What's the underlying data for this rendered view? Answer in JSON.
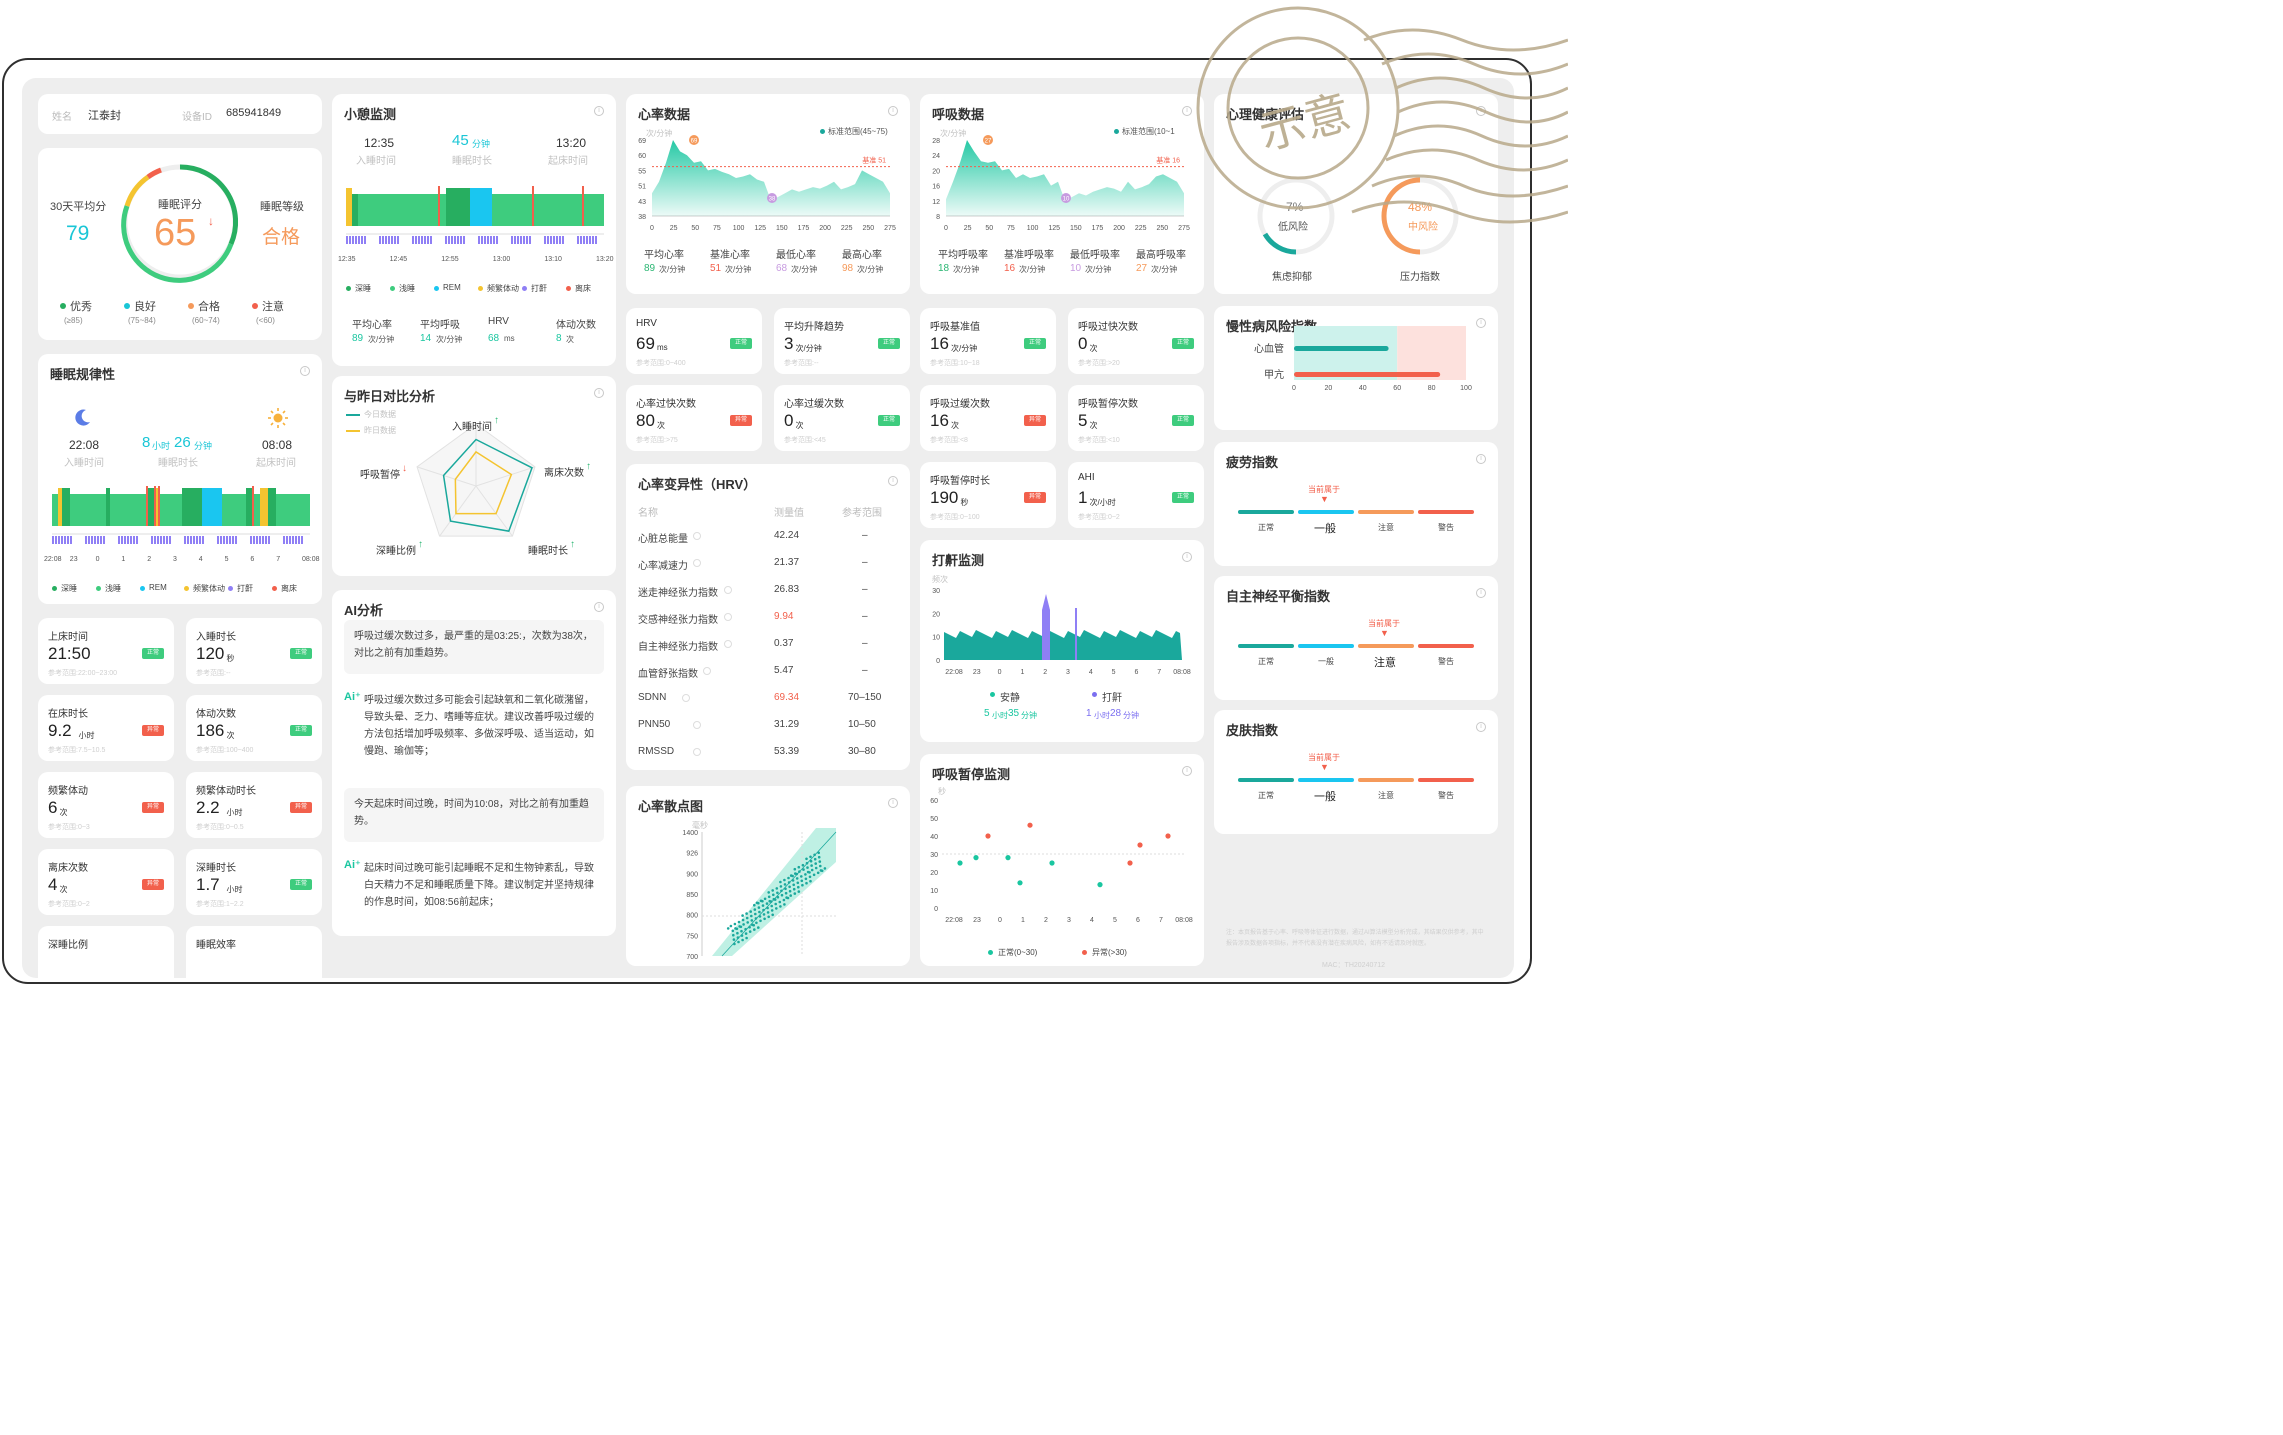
{
  "stamp": {
    "text": "示意"
  },
  "user": {
    "name_label": "姓名",
    "name": "江泰封",
    "device_label": "设备ID",
    "device_id": "685941849"
  },
  "score": {
    "avg_label": "30天平均分",
    "avg_value": "79",
    "score_label": "睡眠评分",
    "score_value": "65",
    "score_arrow": "↓",
    "level_label": "睡眠等级",
    "level_value": "合格",
    "legend": [
      {
        "name": "优秀",
        "range": "(≥85)",
        "color": "#27ae60"
      },
      {
        "name": "良好",
        "range": "(75~84)",
        "color": "#1ac6d6"
      },
      {
        "name": "合格",
        "range": "(60~74)",
        "color": "#f59a5b"
      },
      {
        "name": "注意",
        "range": "(<60)",
        "color": "#f2604c"
      }
    ]
  },
  "regularity": {
    "title": "睡眠规律性",
    "sleep_time": "22:08",
    "sleep_label": "入睡时间",
    "dur_h": "8",
    "dur_h_unit": "小时",
    "dur_m": "26",
    "dur_m_unit": "分钟",
    "dur_label": "睡眠时长",
    "wake_time": "08:08",
    "wake_label": "起床时间",
    "ticks": [
      "22:08",
      "23",
      "0",
      "1",
      "2",
      "3",
      "4",
      "5",
      "6",
      "7",
      "08:08"
    ],
    "legend": [
      "深睡",
      "浅睡",
      "REM",
      "频繁体动",
      "打鼾",
      "离床"
    ]
  },
  "metrics_left": [
    {
      "label": "上床时间",
      "value": "21:50",
      "unit": "",
      "ref": "参考范围:22:00~23:00",
      "status": "正常",
      "ok": true
    },
    {
      "label": "入睡时长",
      "value": "120",
      "unit": "秒",
      "ref": "参考范围:--",
      "status": "正常",
      "ok": true
    },
    {
      "label": "在床时长",
      "value": "9.2",
      "unit": "小时",
      "ref": "参考范围:7.5~10.5",
      "status": "异常",
      "ok": false
    },
    {
      "label": "体动次数",
      "value": "186",
      "unit": "次",
      "ref": "参考范围:100~400",
      "status": "正常",
      "ok": true
    },
    {
      "label": "频繁体动",
      "value": "6",
      "unit": "次",
      "ref": "参考范围:0~3",
      "status": "异常",
      "ok": false
    },
    {
      "label": "频繁体动时长",
      "value": "2.2",
      "unit": "小时",
      "ref": "参考范围:0~0.5",
      "status": "异常",
      "ok": false
    },
    {
      "label": "离床次数",
      "value": "4",
      "unit": "次",
      "ref": "参考范围:0~2",
      "status": "异常",
      "ok": false
    },
    {
      "label": "深睡时长",
      "value": "1.7",
      "unit": "小时",
      "ref": "参考范围:1~2.2",
      "status": "正常",
      "ok": true
    },
    {
      "label": "深睡比例",
      "value": "",
      "unit": "",
      "ref": "",
      "status": "",
      "ok": true
    },
    {
      "label": "睡眠效率",
      "value": "",
      "unit": "",
      "ref": "",
      "status": "",
      "ok": true
    }
  ],
  "nap": {
    "title": "小憩监测",
    "sleep_time": "12:35",
    "sleep_label": "入睡时间",
    "dur": "45",
    "dur_unit": "分钟",
    "dur_label": "睡眠时长",
    "wake_time": "13:20",
    "wake_label": "起床时间",
    "ticks": [
      "12:35",
      "12:45",
      "12:55",
      "13:00",
      "13:10",
      "13:20"
    ],
    "legend": [
      "深睡",
      "浅睡",
      "REM",
      "频繁体动",
      "打鼾",
      "离床"
    ],
    "stats": [
      {
        "label": "平均心率",
        "value": "89",
        "unit": "次/分钟"
      },
      {
        "label": "平均呼吸",
        "value": "14",
        "unit": "次/分钟"
      },
      {
        "label": "HRV",
        "value": "68",
        "unit": "ms"
      },
      {
        "label": "体动次数",
        "value": "8",
        "unit": "次"
      }
    ]
  },
  "compare": {
    "title": "与昨日对比分析",
    "legend_today": "今日数据",
    "legend_yesterday": "昨日数据",
    "axes": [
      {
        "label": "入睡时间",
        "dir": "↑",
        "up": true
      },
      {
        "label": "离床次数",
        "dir": "↑",
        "up": true
      },
      {
        "label": "睡眠时长",
        "dir": "↑",
        "up": true
      },
      {
        "label": "深睡比例",
        "dir": "↑",
        "up": true
      },
      {
        "label": "呼吸暂停",
        "dir": "↓",
        "up": false
      }
    ]
  },
  "ai": {
    "title": "AI分析",
    "items": [
      {
        "type": "note",
        "text": "呼吸过缓次数过多，最严重的是03:25:，次数为38次，对比之前有加重趋势。"
      },
      {
        "type": "ai",
        "text": "呼吸过缓次数过多可能会引起缺氧和二氧化碳潴留，导致头晕、乏力、嗜睡等症状。建议改善呼吸过缓的方法包括增加呼吸频率、多做深呼吸、适当运动，如慢跑、瑜伽等；"
      },
      {
        "type": "note",
        "text": "今天起床时间过晚，时间为10:08，对比之前有加重趋势。"
      },
      {
        "type": "ai",
        "text": "起床时间过晚可能引起睡眠不足和生物钟紊乱，导致白天精力不足和睡眠质量下降。建议制定并坚持规律的作息时间，如08:56前起床；"
      }
    ]
  },
  "heart": {
    "title": "心率数据",
    "unit": "次/分钟",
    "legend": "标准范围(45~75)",
    "yticks": [
      "69",
      "60",
      "55",
      "51",
      "43",
      "38"
    ],
    "xticks": [
      "0",
      "25",
      "50",
      "75",
      "100",
      "125",
      "150",
      "175",
      "200",
      "225",
      "250",
      "275"
    ],
    "peak": "69",
    "low": "38",
    "base_label": "基准 51",
    "stats": [
      {
        "label": "平均心率",
        "value": "89",
        "unit": "次/分钟",
        "color": "#2bb673"
      },
      {
        "label": "基准心率",
        "value": "51",
        "unit": "次/分钟",
        "color": "#f2604c"
      },
      {
        "label": "最低心率",
        "value": "68",
        "unit": "次/分钟",
        "color": "#c79be0"
      },
      {
        "label": "最高心率",
        "value": "98",
        "unit": "次/分钟",
        "color": "#f59a5b"
      }
    ]
  },
  "resp": {
    "title": "呼吸数据",
    "unit": "次/分钟",
    "legend": "标准范围(10~1",
    "yticks": [
      "28",
      "24",
      "20",
      "16",
      "12",
      "8"
    ],
    "xticks": [
      "0",
      "25",
      "50",
      "75",
      "100",
      "125",
      "150",
      "175",
      "200",
      "225",
      "250",
      "275"
    ],
    "peak": "27",
    "low": "10",
    "base_label": "基准 16",
    "stats": [
      {
        "label": "平均呼吸率",
        "value": "18",
        "unit": "次/分钟",
        "color": "#2bb673"
      },
      {
        "label": "基准呼吸率",
        "value": "16",
        "unit": "次/分钟",
        "color": "#f2604c"
      },
      {
        "label": "最低呼吸率",
        "value": "10",
        "unit": "次/分钟",
        "color": "#c79be0"
      },
      {
        "label": "最高呼吸率",
        "value": "27",
        "unit": "次/分钟",
        "color": "#f59a5b"
      }
    ]
  },
  "metrics_mid": [
    {
      "label": "HRV",
      "value": "69",
      "unit": "ms",
      "ref": "参考范围:0~400",
      "status": "正常",
      "ok": true
    },
    {
      "label": "平均升降趋势",
      "value": "3",
      "unit": "次/分钟",
      "ref": "参考范围:--",
      "status": "正常",
      "ok": true
    },
    {
      "label": "心率过快次数",
      "value": "80",
      "unit": "次",
      "ref": "参考范围:>75",
      "status": "异常",
      "ok": false
    },
    {
      "label": "心率过缓次数",
      "value": "0",
      "unit": "次",
      "ref": "参考范围:<45",
      "status": "正常",
      "ok": true
    }
  ],
  "metrics_resp": [
    {
      "label": "呼吸基准值",
      "value": "16",
      "unit": "次/分钟",
      "ref": "参考范围:10~18",
      "status": "正常",
      "ok": true
    },
    {
      "label": "呼吸过快次数",
      "value": "0",
      "unit": "次",
      "ref": "参考范围:>20",
      "status": "正常",
      "ok": true
    },
    {
      "label": "呼吸过缓次数",
      "value": "16",
      "unit": "次",
      "ref": "参考范围:<8",
      "status": "异常",
      "ok": false
    },
    {
      "label": "呼吸暂停次数",
      "value": "5",
      "unit": "次",
      "ref": "参考范围:<10",
      "status": "正常",
      "ok": true
    },
    {
      "label": "呼吸暂停时长",
      "value": "190",
      "unit": "秒",
      "ref": "参考范围:0~100",
      "status": "异常",
      "ok": false
    },
    {
      "label": "AHI",
      "value": "1",
      "unit": "次/小时",
      "ref": "参考范围:0~2",
      "status": "正常",
      "ok": true
    }
  ],
  "hrv": {
    "title": "心率变异性（HRV）",
    "headers": [
      "名称",
      "测量值",
      "参考范围"
    ],
    "rows": [
      {
        "name": "心脏总能量",
        "value": "42.24",
        "range": "–",
        "alert": false
      },
      {
        "name": "心率减速力",
        "value": "21.37",
        "range": "–",
        "alert": false
      },
      {
        "name": "迷走神经张力指数",
        "value": "26.83",
        "range": "–",
        "alert": false
      },
      {
        "name": "交感神经张力指数",
        "value": "9.94",
        "range": "–",
        "alert": true
      },
      {
        "name": "自主神经张力指数",
        "value": "0.37",
        "range": "–",
        "alert": false
      },
      {
        "name": "血管舒张指数",
        "value": "5.47",
        "range": "–",
        "alert": false
      },
      {
        "name": "SDNN",
        "value": "69.34",
        "range": "70–150",
        "alert": true
      },
      {
        "name": "PNN50",
        "value": "31.29",
        "range": "10–50",
        "alert": false
      },
      {
        "name": "RMSSD",
        "value": "53.39",
        "range": "30–80",
        "alert": false
      }
    ]
  },
  "scatter": {
    "title": "心率散点图",
    "unit": "毫秒",
    "yticks": [
      "1400",
      "926",
      "900",
      "850",
      "800",
      "750",
      "700"
    ]
  },
  "snore": {
    "title": "打鼾监测",
    "unit": "频次",
    "yticks": [
      "30",
      "20",
      "10",
      "0"
    ],
    "xticks": [
      "22:08",
      "23",
      "0",
      "1",
      "2",
      "3",
      "4",
      "5",
      "6",
      "7",
      "08:08"
    ],
    "quiet_label": "安静",
    "quiet_h": "5",
    "quiet_m": "35",
    "snore_label": "打鼾",
    "snore_h": "1",
    "snore_m": "28",
    "h_unit": "小时",
    "m_unit": "分钟"
  },
  "apnea": {
    "title": "呼吸暂停监测",
    "unit": "秒",
    "yticks": [
      "60",
      "50",
      "40",
      "30",
      "20",
      "10",
      "0"
    ],
    "xticks": [
      "22:08",
      "23",
      "0",
      "1",
      "2",
      "3",
      "4",
      "5",
      "6",
      "7",
      "08:08"
    ],
    "normal_label": "正常(0~30)",
    "abnormal_label": "异常(>30)"
  },
  "mental": {
    "title": "心理健康评估",
    "anxiety_pct": "7%",
    "anxiety_level": "低风险",
    "anxiety_label": "焦虑抑郁",
    "stress_pct": "48%",
    "stress_level": "中风险",
    "stress_label": "压力指数"
  },
  "chronic": {
    "title": "慢性病风险指数",
    "items": [
      {
        "label": "心血管",
        "value": 55
      },
      {
        "label": "甲亢",
        "value": 85
      }
    ],
    "xticks": [
      "0",
      "20",
      "40",
      "60",
      "80",
      "100"
    ]
  },
  "fatigue": {
    "title": "疲劳指数",
    "current": "当前属于",
    "levels": [
      "正常",
      "一般",
      "注意",
      "警告"
    ],
    "selected": 1
  },
  "ans": {
    "title": "自主神经平衡指数",
    "current": "当前属于",
    "levels": [
      "正常",
      "一般",
      "注意",
      "警告"
    ],
    "selected": 2
  },
  "skin": {
    "title": "皮肤指数",
    "current": "当前属于",
    "levels": [
      "正常",
      "一般",
      "注意",
      "警告"
    ],
    "selected": 1
  },
  "footer": {
    "note": "注：本页报告基于心率、呼吸等体征进行数据，通过AI算法模型分析完成，其结果仅供参考，其中报告涉及数据各项指标，并不代表没有潜在疾病风险，如有不适请及时就医。",
    "mac": "MAC：TH20240712"
  }
}
